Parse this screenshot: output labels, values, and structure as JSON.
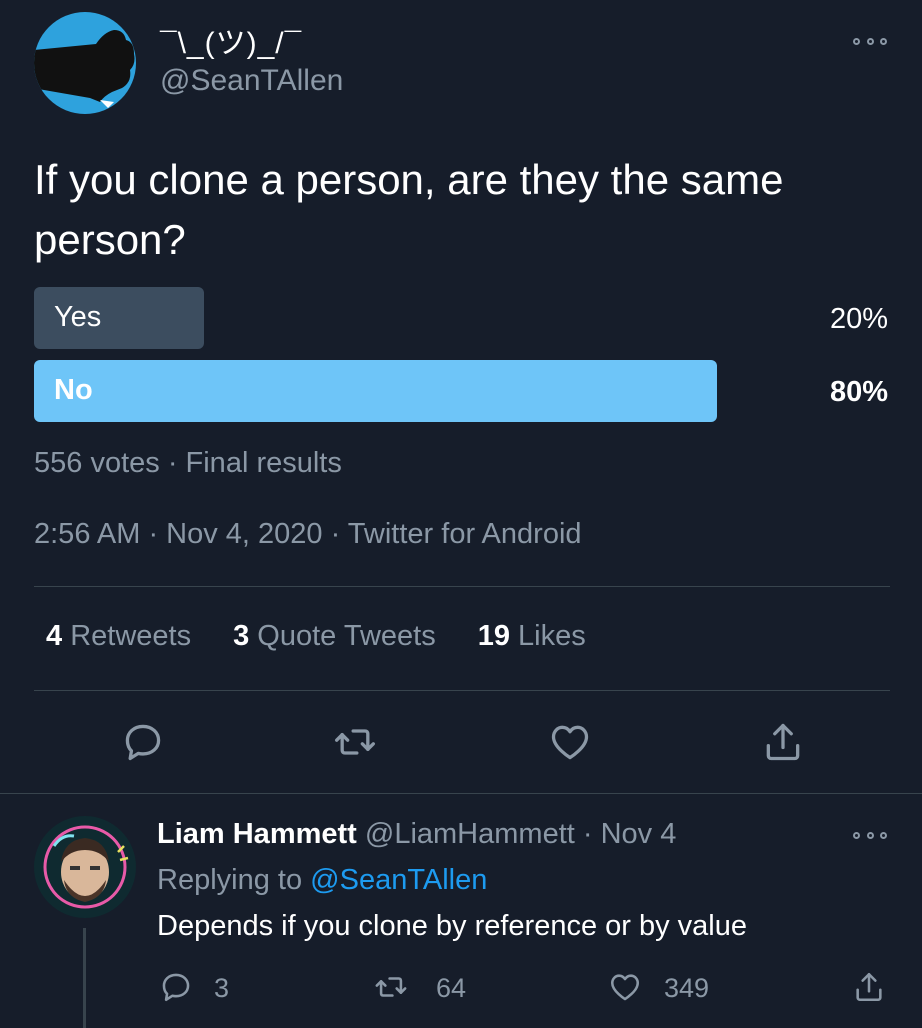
{
  "tweet": {
    "display_name": "¯\\_(ツ)_/¯",
    "handle": "@SeanTAllen",
    "text": "If you clone a person, are they the same person?",
    "poll": {
      "options": [
        {
          "label": "Yes",
          "percent_text": "20%",
          "percent": 20,
          "winner": false
        },
        {
          "label": "No",
          "percent_text": "80%",
          "percent": 80,
          "winner": true
        }
      ],
      "summary": "556 votes · Final results"
    },
    "timestamp": "2:56 AM · Nov 4, 2020 · Twitter for Android",
    "stats": {
      "retweets_count": "4",
      "retweets_label": "Retweets",
      "quotes_count": "3",
      "quotes_label": "Quote Tweets",
      "likes_count": "19",
      "likes_label": "Likes"
    },
    "actions": [
      "reply-icon",
      "retweet-icon",
      "like-icon",
      "share-icon"
    ]
  },
  "reply": {
    "display_name": "Liam Hammett",
    "handle": "@LiamHammett",
    "date": "· Nov 4",
    "replying_prefix": "Replying to",
    "replying_to": "@SeanTAllen",
    "text": "Depends if you clone by reference or by value",
    "reply_count": "3",
    "retweet_count": "64",
    "like_count": "349"
  },
  "colors": {
    "background": "#161d2a",
    "winner_bar": "#6ec5f8",
    "loser_bar": "#3c4d5f",
    "secondary_text": "#8b98a6",
    "link": "#1d9bf0",
    "avatar_bg": "#2ea2dd"
  }
}
